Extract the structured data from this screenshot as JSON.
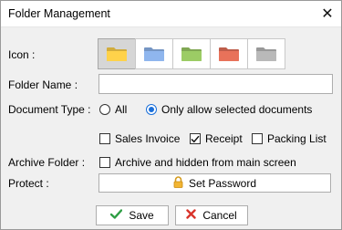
{
  "window": {
    "title": "Folder Management",
    "close_glyph": "✕"
  },
  "labels": {
    "icon": "Icon :",
    "folder_name": "Folder Name :",
    "document_type": "Document Type :",
    "archive_folder": "Archive Folder :",
    "protect": "Protect :"
  },
  "icons": [
    {
      "name": "yellow-folder-icon",
      "color": "#ffd24a",
      "selected": true
    },
    {
      "name": "blue-folder-icon",
      "color": "#8fb6ee",
      "selected": false
    },
    {
      "name": "green-folder-icon",
      "color": "#9ccc65",
      "selected": false
    },
    {
      "name": "red-folder-icon",
      "color": "#e8725a",
      "selected": false
    },
    {
      "name": "gray-folder-icon",
      "color": "#b9b9b9",
      "selected": false
    }
  ],
  "folder_name": {
    "value": "",
    "placeholder": ""
  },
  "document_type": {
    "options": [
      {
        "label": "All",
        "checked": false
      },
      {
        "label": "Only allow selected documents",
        "checked": true
      }
    ]
  },
  "documents": [
    {
      "label": "Sales Invoice",
      "checked": false
    },
    {
      "label": "Receipt",
      "checked": true
    },
    {
      "label": "Packing List",
      "checked": false
    }
  ],
  "archive": {
    "label": "Archive and hidden from main screen",
    "checked": false
  },
  "protect": {
    "button_label": "Set Password",
    "icon": "lock-icon"
  },
  "buttons": {
    "save": "Save",
    "cancel": "Cancel",
    "save_icon": "checkmark-icon",
    "cancel_icon": "x-icon",
    "save_color": "#2e9e45",
    "cancel_color": "#d9342b"
  }
}
